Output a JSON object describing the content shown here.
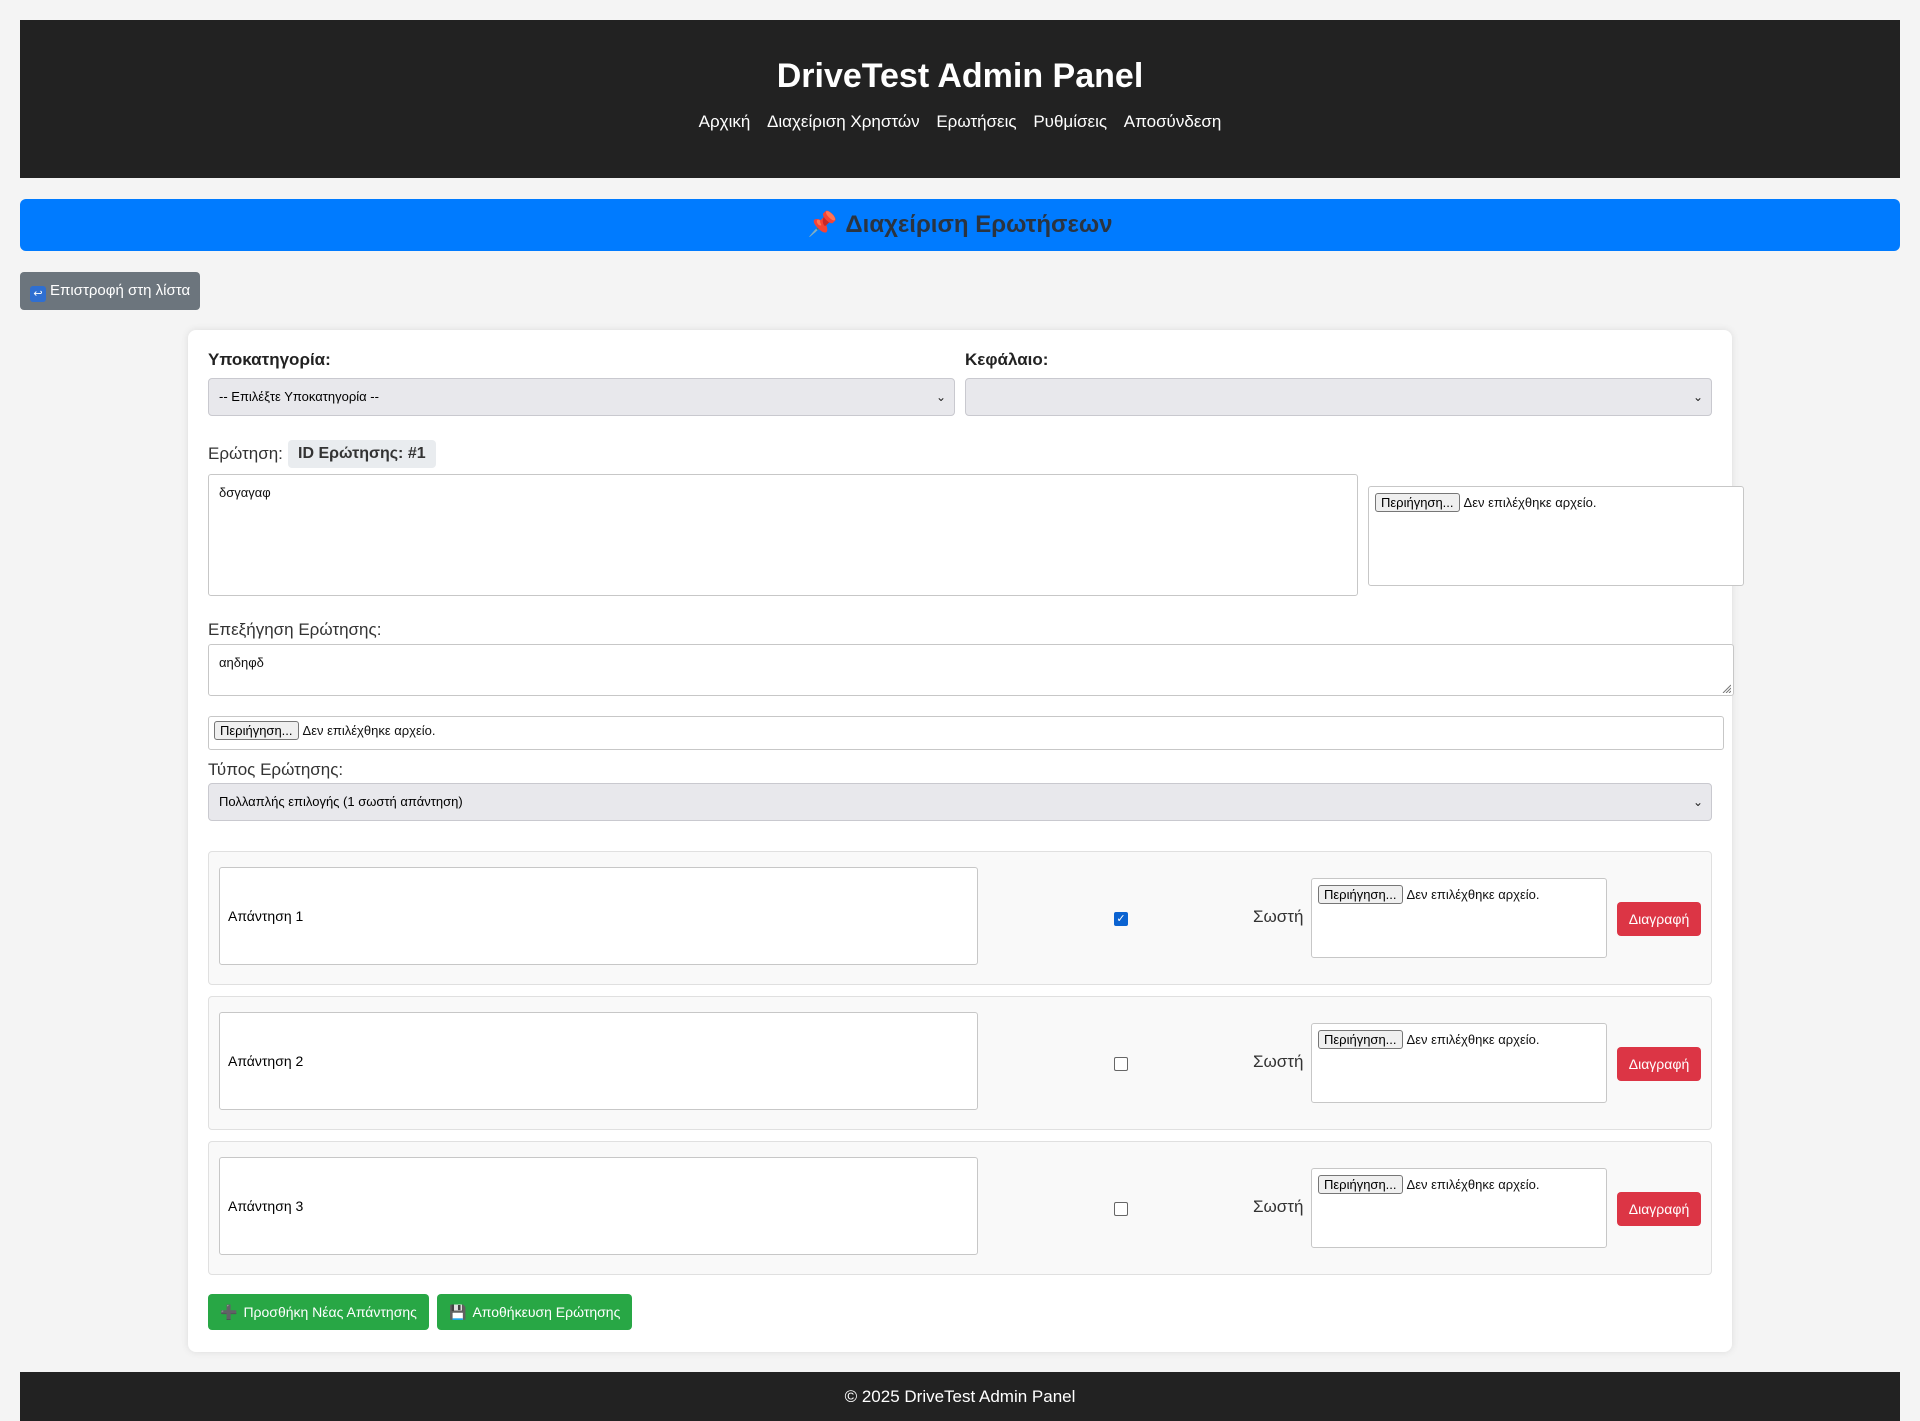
{
  "header": {
    "title": "DriveTest Admin Panel",
    "nav": [
      "Αρχική",
      "Διαχείριση Χρηστών",
      "Ερωτήσεις",
      "Ρυθμίσεις",
      "Αποσύνδεση"
    ]
  },
  "banner": {
    "icon": "📌",
    "title": "Διαχείριση Ερωτήσεων"
  },
  "back_button": {
    "icon": "↩",
    "label": "Επιστροφή στη λίστα"
  },
  "form": {
    "subcategory_label": "Υποκατηγορία:",
    "subcategory_value": "-- Επιλέξτε Υποκατηγορία --",
    "chapter_label": "Κεφάλαιο:",
    "chapter_value": "",
    "question_label": "Ερώτηση:",
    "question_id_badge": "ID Ερώτησης: #1",
    "question_text": "δσγαγαφ",
    "explanation_label": "Επεξήγηση Ερώτησης:",
    "explanation_text": "αηδηφδ",
    "type_label": "Τύπος Ερώτησης:",
    "type_value": "Πολλαπλής επιλογής (1 σωστή απάντηση)",
    "file_button": "Περιήγηση...",
    "file_none": "Δεν επιλέχθηκε αρχείο."
  },
  "answers": [
    {
      "text": "Απάντηση 1",
      "correct": true,
      "correct_label": "Σωστή",
      "delete_label": "Διαγραφή"
    },
    {
      "text": "Απάντηση 2",
      "correct": false,
      "correct_label": "Σωστή",
      "delete_label": "Διαγραφή"
    },
    {
      "text": "Απάντηση 3",
      "correct": false,
      "correct_label": "Σωστή",
      "delete_label": "Διαγραφή"
    }
  ],
  "actions": {
    "add_icon": "➕",
    "add_label": "Προσθήκη Νέας Απάντησης",
    "save_icon": "💾",
    "save_label": "Αποθήκευση Ερώτησης"
  },
  "footer": {
    "text": "© 2025 DriveTest Admin Panel"
  },
  "colors": {
    "header_bg": "#222222",
    "banner_bg": "#007bff",
    "back_btn": "#6c757d",
    "delete_btn": "#dc3545",
    "green_btn": "#28a745"
  }
}
